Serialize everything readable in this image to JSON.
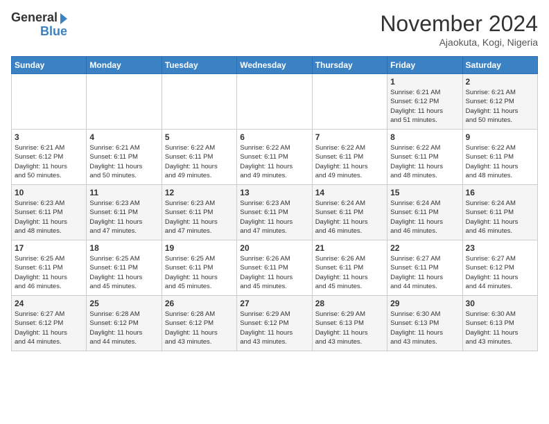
{
  "logo": {
    "line1": "General",
    "line2": "Blue"
  },
  "title": "November 2024",
  "location": "Ajaokuta, Kogi, Nigeria",
  "days_of_week": [
    "Sunday",
    "Monday",
    "Tuesday",
    "Wednesday",
    "Thursday",
    "Friday",
    "Saturday"
  ],
  "weeks": [
    [
      {
        "day": "",
        "info": ""
      },
      {
        "day": "",
        "info": ""
      },
      {
        "day": "",
        "info": ""
      },
      {
        "day": "",
        "info": ""
      },
      {
        "day": "",
        "info": ""
      },
      {
        "day": "1",
        "info": "Sunrise: 6:21 AM\nSunset: 6:12 PM\nDaylight: 11 hours\nand 51 minutes."
      },
      {
        "day": "2",
        "info": "Sunrise: 6:21 AM\nSunset: 6:12 PM\nDaylight: 11 hours\nand 50 minutes."
      }
    ],
    [
      {
        "day": "3",
        "info": "Sunrise: 6:21 AM\nSunset: 6:12 PM\nDaylight: 11 hours\nand 50 minutes."
      },
      {
        "day": "4",
        "info": "Sunrise: 6:21 AM\nSunset: 6:11 PM\nDaylight: 11 hours\nand 50 minutes."
      },
      {
        "day": "5",
        "info": "Sunrise: 6:22 AM\nSunset: 6:11 PM\nDaylight: 11 hours\nand 49 minutes."
      },
      {
        "day": "6",
        "info": "Sunrise: 6:22 AM\nSunset: 6:11 PM\nDaylight: 11 hours\nand 49 minutes."
      },
      {
        "day": "7",
        "info": "Sunrise: 6:22 AM\nSunset: 6:11 PM\nDaylight: 11 hours\nand 49 minutes."
      },
      {
        "day": "8",
        "info": "Sunrise: 6:22 AM\nSunset: 6:11 PM\nDaylight: 11 hours\nand 48 minutes."
      },
      {
        "day": "9",
        "info": "Sunrise: 6:22 AM\nSunset: 6:11 PM\nDaylight: 11 hours\nand 48 minutes."
      }
    ],
    [
      {
        "day": "10",
        "info": "Sunrise: 6:23 AM\nSunset: 6:11 PM\nDaylight: 11 hours\nand 48 minutes."
      },
      {
        "day": "11",
        "info": "Sunrise: 6:23 AM\nSunset: 6:11 PM\nDaylight: 11 hours\nand 47 minutes."
      },
      {
        "day": "12",
        "info": "Sunrise: 6:23 AM\nSunset: 6:11 PM\nDaylight: 11 hours\nand 47 minutes."
      },
      {
        "day": "13",
        "info": "Sunrise: 6:23 AM\nSunset: 6:11 PM\nDaylight: 11 hours\nand 47 minutes."
      },
      {
        "day": "14",
        "info": "Sunrise: 6:24 AM\nSunset: 6:11 PM\nDaylight: 11 hours\nand 46 minutes."
      },
      {
        "day": "15",
        "info": "Sunrise: 6:24 AM\nSunset: 6:11 PM\nDaylight: 11 hours\nand 46 minutes."
      },
      {
        "day": "16",
        "info": "Sunrise: 6:24 AM\nSunset: 6:11 PM\nDaylight: 11 hours\nand 46 minutes."
      }
    ],
    [
      {
        "day": "17",
        "info": "Sunrise: 6:25 AM\nSunset: 6:11 PM\nDaylight: 11 hours\nand 46 minutes."
      },
      {
        "day": "18",
        "info": "Sunrise: 6:25 AM\nSunset: 6:11 PM\nDaylight: 11 hours\nand 45 minutes."
      },
      {
        "day": "19",
        "info": "Sunrise: 6:25 AM\nSunset: 6:11 PM\nDaylight: 11 hours\nand 45 minutes."
      },
      {
        "day": "20",
        "info": "Sunrise: 6:26 AM\nSunset: 6:11 PM\nDaylight: 11 hours\nand 45 minutes."
      },
      {
        "day": "21",
        "info": "Sunrise: 6:26 AM\nSunset: 6:11 PM\nDaylight: 11 hours\nand 45 minutes."
      },
      {
        "day": "22",
        "info": "Sunrise: 6:27 AM\nSunset: 6:11 PM\nDaylight: 11 hours\nand 44 minutes."
      },
      {
        "day": "23",
        "info": "Sunrise: 6:27 AM\nSunset: 6:12 PM\nDaylight: 11 hours\nand 44 minutes."
      }
    ],
    [
      {
        "day": "24",
        "info": "Sunrise: 6:27 AM\nSunset: 6:12 PM\nDaylight: 11 hours\nand 44 minutes."
      },
      {
        "day": "25",
        "info": "Sunrise: 6:28 AM\nSunset: 6:12 PM\nDaylight: 11 hours\nand 44 minutes."
      },
      {
        "day": "26",
        "info": "Sunrise: 6:28 AM\nSunset: 6:12 PM\nDaylight: 11 hours\nand 43 minutes."
      },
      {
        "day": "27",
        "info": "Sunrise: 6:29 AM\nSunset: 6:12 PM\nDaylight: 11 hours\nand 43 minutes."
      },
      {
        "day": "28",
        "info": "Sunrise: 6:29 AM\nSunset: 6:13 PM\nDaylight: 11 hours\nand 43 minutes."
      },
      {
        "day": "29",
        "info": "Sunrise: 6:30 AM\nSunset: 6:13 PM\nDaylight: 11 hours\nand 43 minutes."
      },
      {
        "day": "30",
        "info": "Sunrise: 6:30 AM\nSunset: 6:13 PM\nDaylight: 11 hours\nand 43 minutes."
      }
    ]
  ]
}
